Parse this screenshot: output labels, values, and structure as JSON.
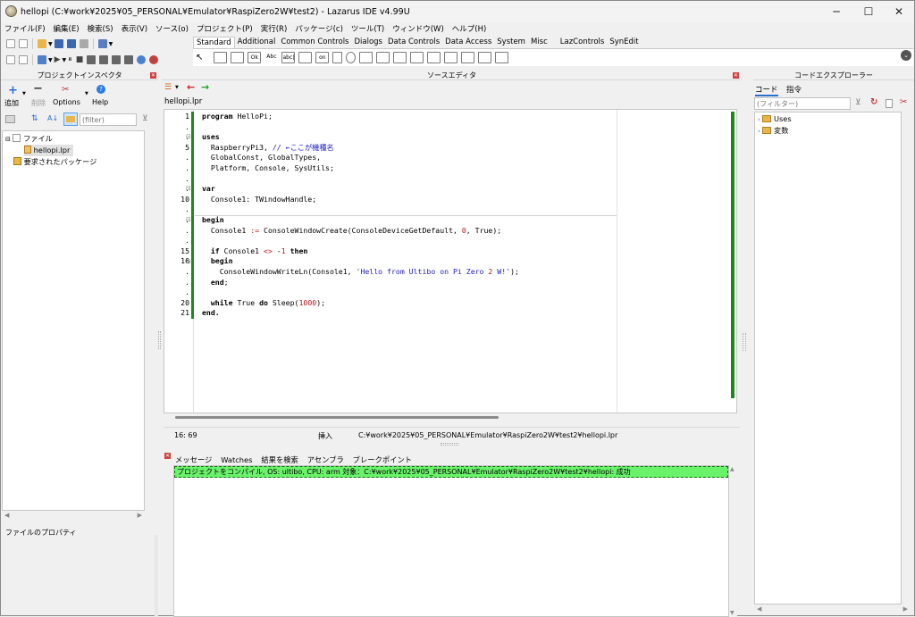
{
  "window": {
    "title": "hellopi (C:¥work¥2025¥05_PERSONAL¥Emulator¥RaspiZero2W¥test2) - Lazarus IDE v4.99U",
    "min_glyph": "─",
    "max_glyph": "☐",
    "close_glyph": "✕"
  },
  "menu": [
    "ファイル(F)",
    "編集(E)",
    "検索(S)",
    "表示(V)",
    "ソース(o)",
    "プロジェクト(P)",
    "実行(R)",
    "パッケージ(c)",
    "ツール(T)",
    "ウィンドウ(W)",
    "ヘルプ(H)"
  ],
  "palette_tabs": [
    "Standard",
    "Additional",
    "Common Controls",
    "Dialogs",
    "Data Controls",
    "Data Access",
    "System",
    "Misc",
    "LazControls",
    "SynEdit"
  ],
  "palette_labels": {
    "ok": "Ok",
    "abc": "Abc",
    "abc2": "abc|",
    "on": "on"
  },
  "inspector": {
    "title": "プロジェクトインスペクタ",
    "add": "追加",
    "remove": "削除",
    "options": "Options",
    "help": "Help",
    "filter_placeholder": "(filter)",
    "tree": {
      "files": "ファイル",
      "file1": "hellopi.lpr",
      "packages": "要求されたパッケージ"
    },
    "props_title": "ファイルのプロパティ"
  },
  "editor": {
    "title": "ソースエディタ",
    "tab": "hellopi.lpr",
    "gutter": [
      "1",
      ".",
      ".",
      "5",
      ".",
      ".",
      ".",
      ".",
      "10",
      ".",
      ".",
      ".",
      ".",
      "15",
      "16",
      ".",
      ".",
      ".",
      "20",
      "21"
    ],
    "status_pos": "16: 69",
    "status_mode": "挿入",
    "status_path": "C:¥work¥2025¥05_PERSONAL¥Emulator¥RaspiZero2W¥test2¥hellopi.lpr"
  },
  "code_lines": [
    {
      "kw": "program",
      "rest": " HelloPi;"
    },
    {
      "kw": "",
      "rest": ""
    },
    {
      "kw": "uses",
      "rest": ""
    },
    {
      "kw": "",
      "rest": "  RaspberryPi3, ",
      "cm": "// ←ここが機種名"
    },
    {
      "kw": "",
      "rest": "  GlobalConst, GlobalTypes,"
    },
    {
      "kw": "",
      "rest": "  Platform, Console, SysUtils;"
    },
    {
      "kw": "",
      "rest": ""
    },
    {
      "kw": "var",
      "rest": ""
    },
    {
      "kw": "",
      "rest": "  Console1: TWindowHandle;"
    },
    {
      "kw": "",
      "rest": ""
    },
    {
      "kw": "begin",
      "rest": ""
    },
    {
      "kw": "",
      "rest": "  Console1 := ConsoleWindowCreate(ConsoleDeviceGetDefault, 0, True);"
    },
    {
      "kw": "",
      "rest": ""
    },
    {
      "kw": "",
      "rest": "  if Console1 <> -1 then"
    },
    {
      "kw": "",
      "rest": "  begin"
    },
    {
      "kw": "",
      "rest": "    ConsoleWindowWriteLn(Console1, 'Hello from Ultibo on Pi Zero 2 W!');"
    },
    {
      "kw": "",
      "rest": "  end;"
    },
    {
      "kw": "",
      "rest": ""
    },
    {
      "kw": "",
      "rest": "  while True do Sleep(1000);"
    },
    {
      "kw": "end.",
      "rest": ""
    },
    {
      "kw": "",
      "rest": ""
    }
  ],
  "messages": {
    "tabs": [
      "メッセージ",
      "Watches",
      "結果を検索",
      "アセンブラ",
      "ブレークポイント"
    ],
    "line": "プロジェクトをコンパイル, OS: ultibo, CPU: arm 対象：C:¥work¥2025¥05_PERSONAL¥Emulator¥RaspiZero2W¥test2¥hellopi: 成功"
  },
  "explorer": {
    "title": "コードエクスプローラー",
    "tab_code": "コード",
    "tab_directives": "指令",
    "filter_placeholder": "(フィルター)",
    "items": [
      "Uses",
      "変数"
    ]
  }
}
